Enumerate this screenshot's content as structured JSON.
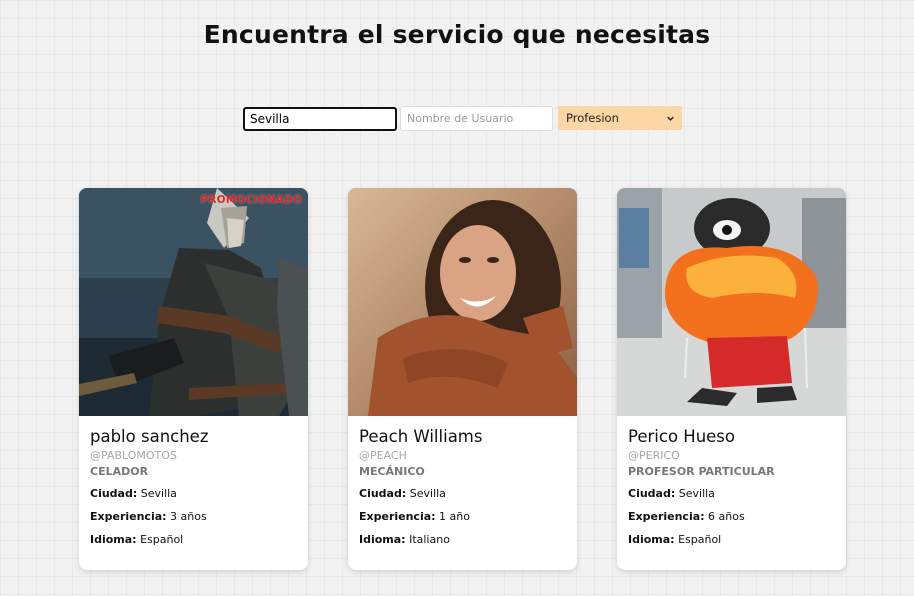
{
  "header": {
    "title": "Encuentra el servicio que necesitas"
  },
  "filters": {
    "city_value": "Sevilla",
    "user_placeholder": "Nombre de Usuario",
    "profession_selected": "Profesion"
  },
  "cards": [
    {
      "promo": "PROMOCIONADO",
      "name": "pablo sanchez",
      "handle": "@pablomotos",
      "profession": "Celador",
      "city_label": "Ciudad:",
      "city": "Sevilla",
      "exp_label": "Experiencia:",
      "experience": "3 años",
      "lang_label": "Idioma:",
      "language": "Español"
    },
    {
      "name": "Peach Williams",
      "handle": "@peach",
      "profession": "Mecánico",
      "city_label": "Ciudad:",
      "city": "Sevilla",
      "exp_label": "Experiencia:",
      "experience": "1 año",
      "lang_label": "Idioma:",
      "language": "Italiano"
    },
    {
      "name": "Perico Hueso",
      "handle": "@perico",
      "profession": "Profesor particular",
      "city_label": "Ciudad:",
      "city": "Sevilla",
      "exp_label": "Experiencia:",
      "experience": "6 años",
      "lang_label": "Idioma:",
      "language": "Español"
    }
  ],
  "colors": {
    "select_bg": "#fcd7a5",
    "promo": "#e02424"
  }
}
